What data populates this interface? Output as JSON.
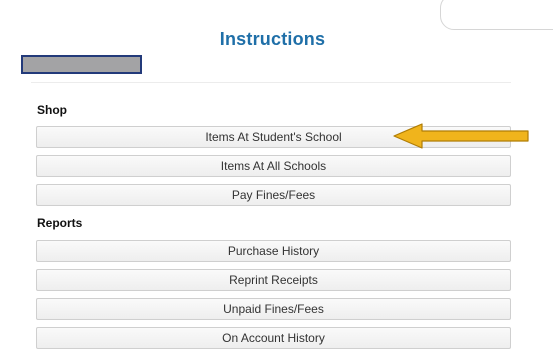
{
  "header": {
    "title": "Instructions"
  },
  "shop": {
    "heading": "Shop",
    "items": [
      "Items At Student's School",
      "Items At All Schools",
      "Pay Fines/Fees"
    ]
  },
  "reports": {
    "heading": "Reports",
    "items": [
      "Purchase History",
      "Reprint Receipts",
      "Unpaid Fines/Fees",
      "On Account History"
    ]
  },
  "colors": {
    "title": "#1f6fa8",
    "arrow": "#f0b41c",
    "redacted_fill": "#a3a3a5",
    "redacted_border": "#233a7a"
  },
  "annotation": {
    "icon": "arrow-left-icon"
  }
}
